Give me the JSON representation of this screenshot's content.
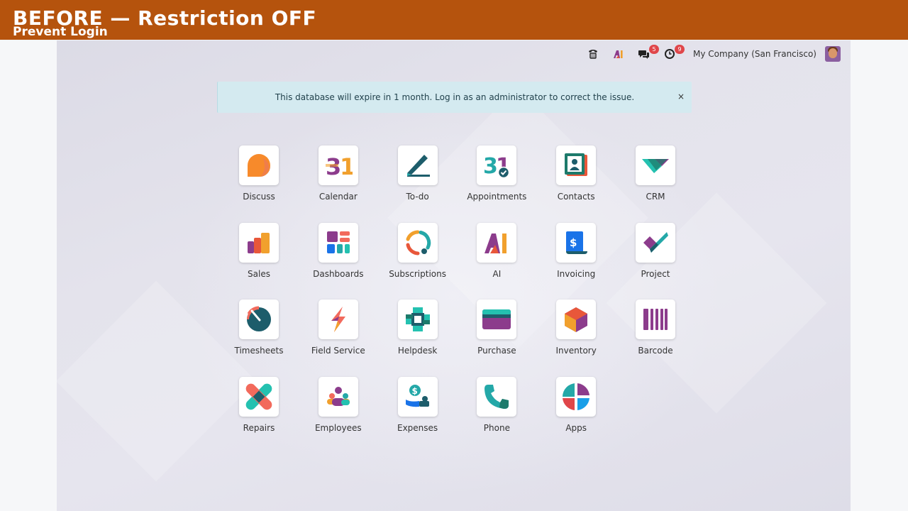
{
  "banner": {
    "title": "BEFORE — Restriction OFF",
    "subtitle": "Prevent Login"
  },
  "systray": {
    "icons": [
      "phone-icon",
      "ai-icon",
      "messaging-icon",
      "activity-clock-icon"
    ],
    "messages_badge": "5",
    "activities_badge": "9",
    "company": "My Company (San Francisco)",
    "status_color": "#1da63a"
  },
  "alert": {
    "text": "This database will expire in 1 month. Log in as an administrator to correct the issue.",
    "close": "×"
  },
  "apps": [
    {
      "label": "Discuss",
      "icon": "discuss-icon"
    },
    {
      "label": "Calendar",
      "icon": "calendar-icon",
      "glyph": "31"
    },
    {
      "label": "To-do",
      "icon": "todo-icon"
    },
    {
      "label": "Appointments",
      "icon": "appointments-icon",
      "glyph": "31"
    },
    {
      "label": "Contacts",
      "icon": "contacts-icon"
    },
    {
      "label": "CRM",
      "icon": "crm-icon"
    },
    {
      "label": "Sales",
      "icon": "sales-icon"
    },
    {
      "label": "Dashboards",
      "icon": "dashboards-icon"
    },
    {
      "label": "Subscriptions",
      "icon": "subscriptions-icon"
    },
    {
      "label": "AI",
      "icon": "ai-app-icon"
    },
    {
      "label": "Invoicing",
      "icon": "invoicing-icon",
      "glyph": "$"
    },
    {
      "label": "Project",
      "icon": "project-icon"
    },
    {
      "label": "Timesheets",
      "icon": "timesheets-icon"
    },
    {
      "label": "Field Service",
      "icon": "field-service-icon"
    },
    {
      "label": "Helpdesk",
      "icon": "helpdesk-icon"
    },
    {
      "label": "Purchase",
      "icon": "purchase-icon"
    },
    {
      "label": "Inventory",
      "icon": "inventory-icon"
    },
    {
      "label": "Barcode",
      "icon": "barcode-icon"
    },
    {
      "label": "Repairs",
      "icon": "repairs-icon"
    },
    {
      "label": "Employees",
      "icon": "employees-icon"
    },
    {
      "label": "Expenses",
      "icon": "expenses-icon",
      "glyph": "$"
    },
    {
      "label": "Phone",
      "icon": "phone-app-icon"
    },
    {
      "label": "Apps",
      "icon": "apps-icon"
    }
  ],
  "colors": {
    "banner": "#b5530d",
    "alert_bg": "#d4eaf0",
    "badge": "#e0464a"
  }
}
